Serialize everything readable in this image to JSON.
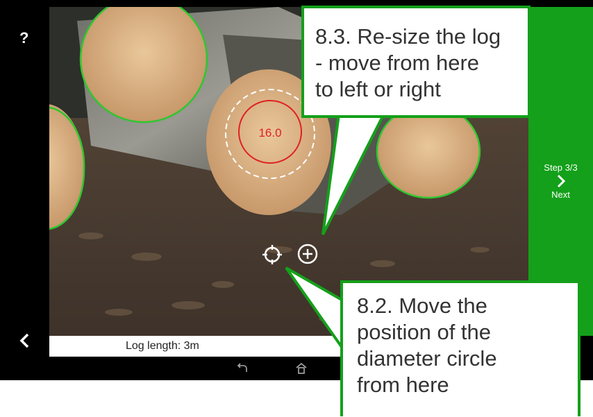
{
  "sidebar": {
    "help_label": "?"
  },
  "log_label": "16.0",
  "right_panel": {
    "step_label": "Step 3/3",
    "next_label": "Next"
  },
  "footer": {
    "log_length": "Log length: 3m"
  },
  "callouts": {
    "resize": [
      "8.3. Re-size the log",
      "- move from here",
      "to left or right"
    ],
    "move": [
      "8.2. Move the",
      "position of the",
      "diameter  circle",
      "from here"
    ]
  },
  "colors": {
    "accent": "#14a01a",
    "measure_circle": "#e02020",
    "log_outline": "#2ec72e"
  },
  "icons": [
    "help-icon",
    "back-chevron-icon",
    "crosshair-icon",
    "resize-plus-icon",
    "next-chevron-icon",
    "nav-back-icon",
    "nav-home-icon"
  ]
}
